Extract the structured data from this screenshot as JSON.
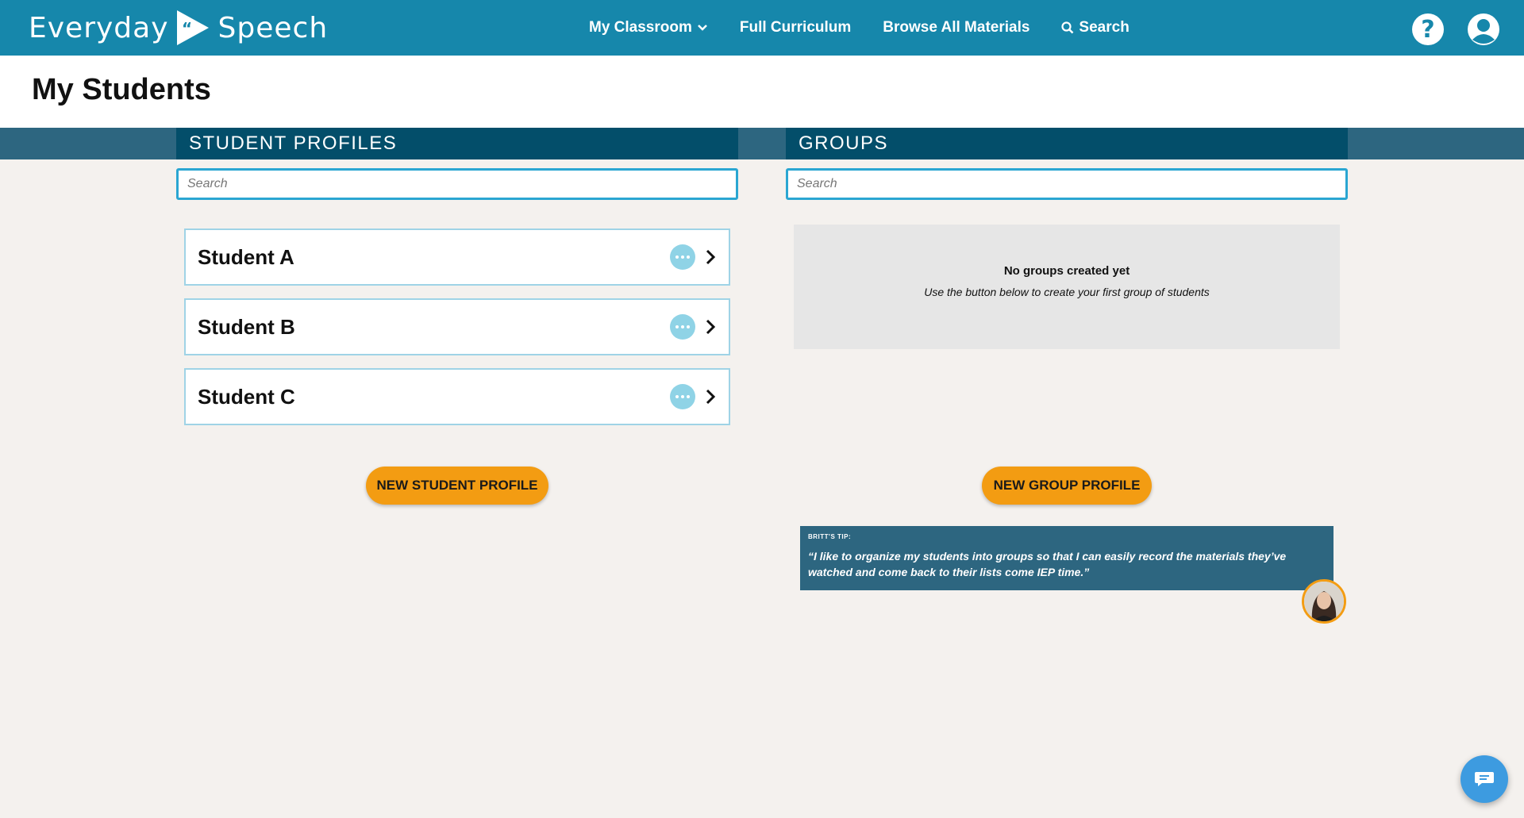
{
  "brand": {
    "name_part1": "Everyday",
    "name_part2": "Speech",
    "color": "#1687ab"
  },
  "nav": {
    "items": [
      {
        "label": "My Classroom",
        "icon": "chevron-down-icon"
      },
      {
        "label": "Full Curriculum"
      },
      {
        "label": "Browse All Materials"
      },
      {
        "label": "Search",
        "icon": "search-icon"
      }
    ],
    "right_icons": [
      "help-icon",
      "account-icon"
    ]
  },
  "page": {
    "title": "My Students"
  },
  "students_section": {
    "heading": "STUDENT PROFILES",
    "search_placeholder": "Search",
    "students": [
      {
        "name": "Student A"
      },
      {
        "name": "Student B"
      },
      {
        "name": "Student C"
      }
    ],
    "new_button_label": "NEW STUDENT PROFILE"
  },
  "groups_section": {
    "heading": "GROUPS",
    "search_placeholder": "Search",
    "empty_title": "No groups created yet",
    "empty_subtitle": "Use the button below to create your first group of students",
    "new_button_label": "NEW GROUP PROFILE"
  },
  "tip": {
    "label": "BRITT'S TIP:",
    "quote": "“I like to organize my students into groups so that I can easily record the materials they’ve watched and come back to their lists come IEP time.”"
  },
  "colors": {
    "accent": "#f39c12",
    "header_dark": "#034e6a",
    "band": "#2d6680",
    "input_border": "#2aa6d2"
  }
}
